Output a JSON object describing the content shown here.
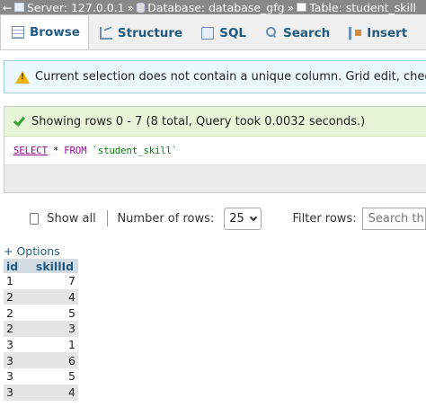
{
  "breadcrumb": {
    "back": "←",
    "server": "Server: 127.0.0.1",
    "database": "Database: database_gfg",
    "table": "Table: student_skill",
    "separator": "»"
  },
  "tabs": [
    {
      "label": "Browse",
      "icon": "browse-icon",
      "active": true
    },
    {
      "label": "Structure",
      "icon": "structure-icon",
      "active": false
    },
    {
      "label": "SQL",
      "icon": "sql-icon",
      "active": false
    },
    {
      "label": "Search",
      "icon": "search-icon",
      "active": false
    },
    {
      "label": "Insert",
      "icon": "insert-icon",
      "active": false
    }
  ],
  "warning": {
    "text": "Current selection does not contain a unique column. Grid edit, checkbox, Edit, Copy and Delete features are not available."
  },
  "result": {
    "message": "Showing rows 0 - 7 (8 total, Query took 0.0032 seconds.)",
    "sql": {
      "select": "SELECT",
      "star": "*",
      "from": "FROM",
      "table": "`student_skill`"
    }
  },
  "controls": {
    "show_all": "Show all",
    "rows_label": "Number of rows:",
    "rows_value": "25",
    "filter_label": "Filter rows:",
    "filter_placeholder": "Search this table"
  },
  "options_link": "+ Options",
  "table": {
    "headers": [
      "id",
      "skillId"
    ],
    "rows": [
      [
        "1",
        "7"
      ],
      [
        "2",
        "4"
      ],
      [
        "2",
        "5"
      ],
      [
        "2",
        "3"
      ],
      [
        "3",
        "1"
      ],
      [
        "3",
        "6"
      ],
      [
        "3",
        "5"
      ],
      [
        "3",
        "4"
      ]
    ]
  },
  "colors": {
    "accent": "#235a81",
    "tab_bar": "#f0f0f0",
    "warning_bg": "#ebf8fd",
    "success_bg": "#e9f5d8",
    "header_bg": "#d3dce3",
    "row_even": "#e5e5e5"
  }
}
